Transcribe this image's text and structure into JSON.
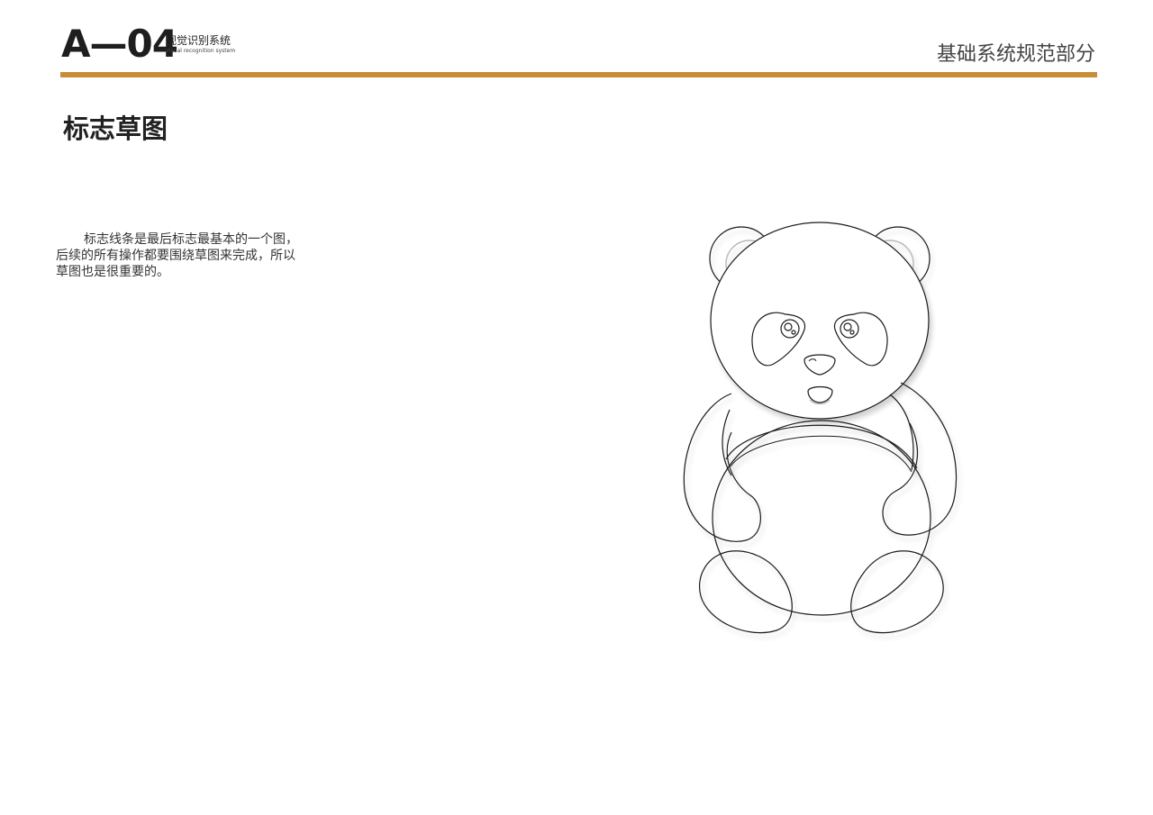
{
  "header": {
    "code": "A—04",
    "system_cn": "视觉识别系统",
    "system_en": "Visual recognition system",
    "section": "基础系统规范部分",
    "accent_color": "#c88d36"
  },
  "page": {
    "title": "标志草图"
  },
  "description": {
    "line1": "标志线条是最后标志最基本的一个图，",
    "line2": "后续的所有操作都要围绕草图来完成，所以",
    "line3": "草图也是很重要的。"
  },
  "illustration": {
    "subject": "panda-line-sketch"
  }
}
